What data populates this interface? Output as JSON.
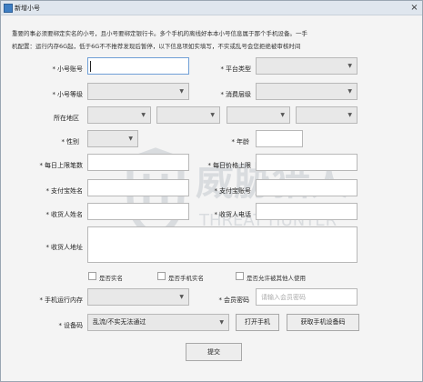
{
  "window": {
    "title": "新增小号",
    "close_icon": "close-icon"
  },
  "notices": [
    "重要的事必须要绑定实名的小号，且小号要绑定银行卡。多个手机的离线好本本小号信息属于那个手机设备。一手",
    "机配置：运行内存6G起，低于6G不不推荐发现后暂停，以下信息项如实填写，不实或乱号会您拒绝被审核时间"
  ],
  "fields": {
    "account_label": "小号账号",
    "account_value": "",
    "platform_label": "平台类型",
    "platform_value": "",
    "level_label": "小号等级",
    "level_value": "",
    "consume_label": "消费层级",
    "consume_value": "",
    "region_label": "所在地区",
    "region_values": [
      "",
      "",
      "",
      ""
    ],
    "gender_label": "性别",
    "gender_value": "",
    "age_label": "年龄",
    "age_value": "",
    "daily_orders_label": "每日上限笔数",
    "daily_orders_value": "",
    "daily_amount_label": "每日价格上限",
    "daily_amount_value": "",
    "alipay_name_label": "支付宝姓名",
    "alipay_name_value": "",
    "alipay_account_label": "支付宝账号",
    "alipay_account_value": "",
    "receiver_name_label": "收货人姓名",
    "receiver_name_value": "",
    "receiver_phone_label": "收货人电话",
    "receiver_phone_value": "",
    "address_label": "收货人地址",
    "address_value": "",
    "memory_label": "手机运行内存",
    "memory_value": "",
    "member_pwd_label": "会员密码",
    "member_pwd_placeholder": "请输入会员密码",
    "device_label": "设备码",
    "device_value": "乱流/不实无法通过"
  },
  "checkboxes": [
    {
      "label": "是否实名",
      "checked": false
    },
    {
      "label": "是否手机实名",
      "checked": false
    },
    {
      "label": "是否允许被其他人使用",
      "checked": false
    }
  ],
  "buttons": {
    "open_phone": "打开手机",
    "get_device_code": "获取手机设备码",
    "submit": "提交"
  },
  "watermark": {
    "line1": "威胁猎人",
    "line2": "THREAT HUNTER"
  }
}
